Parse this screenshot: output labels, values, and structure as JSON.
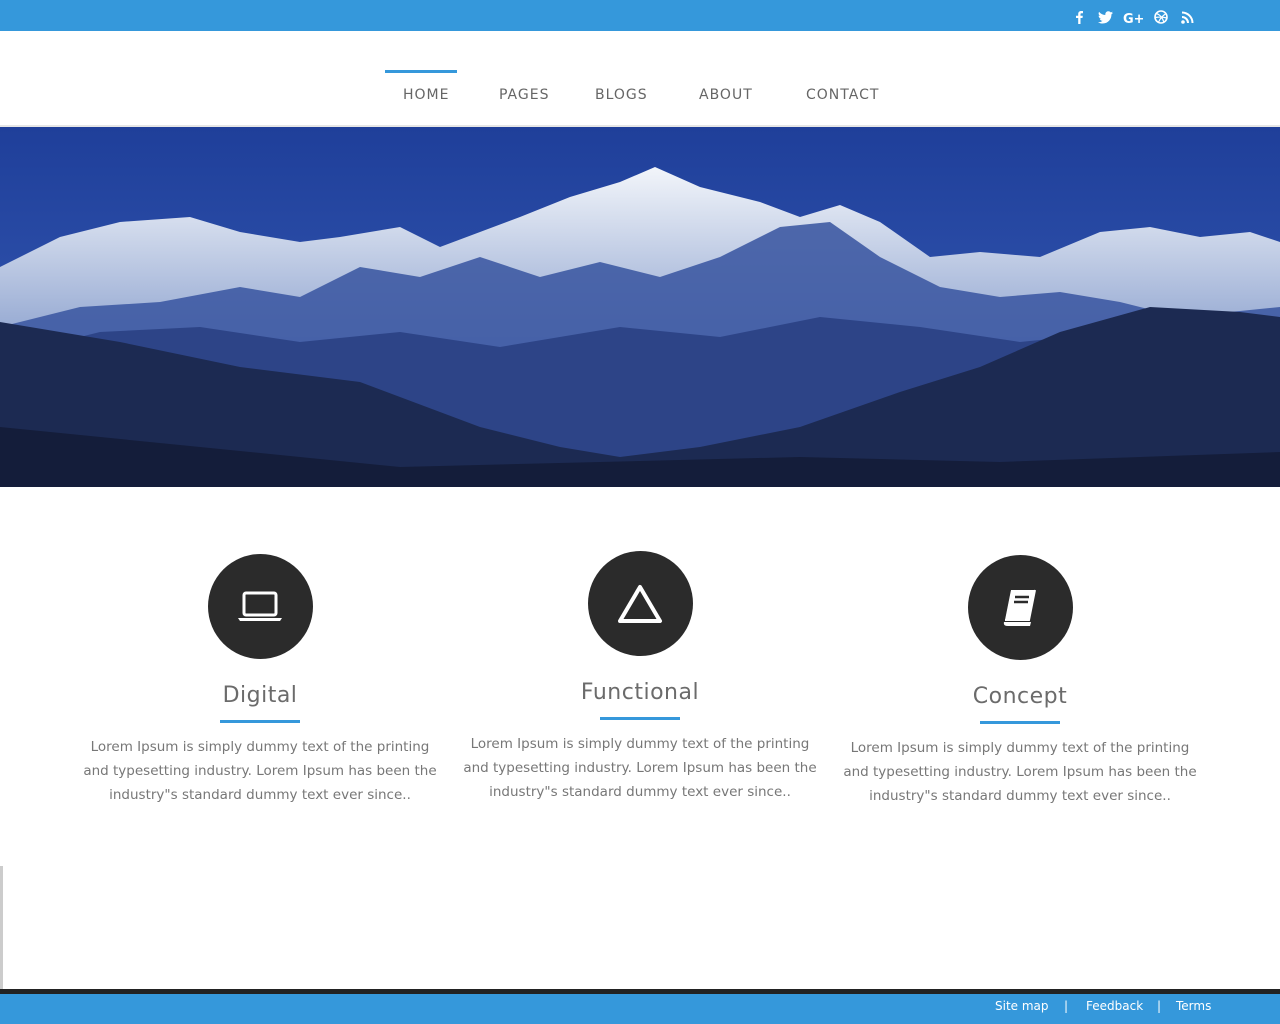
{
  "social": {
    "facebook": "f",
    "twitter": "t",
    "googleplus": "G+",
    "dribbble": "dribbble-icon",
    "rss": "rss-icon"
  },
  "nav": {
    "items": [
      "HOME",
      "PAGES",
      "BLOGS",
      "ABOUT",
      "CONTACT"
    ],
    "active": "HOME"
  },
  "hero": {
    "image": "mountain-range-hero-image"
  },
  "features": [
    {
      "icon": "laptop-icon",
      "title": "Digital",
      "text": "Lorem Ipsum is simply dummy text of the printing and typesetting industry. Lorem Ipsum has been the industry\"s standard dummy text ever since.."
    },
    {
      "icon": "triangle-icon",
      "title": "Functional",
      "text": "Lorem Ipsum is simply dummy text of the printing and typesetting industry. Lorem Ipsum has been the industry\"s standard dummy text ever since.."
    },
    {
      "icon": "book-icon",
      "title": "Concept",
      "text": "Lorem Ipsum is simply dummy text of the printing and typesetting industry. Lorem Ipsum has been the industry\"s standard dummy text ever since.."
    }
  ],
  "footer": {
    "links": [
      "Site map",
      "Feedback",
      "Terms"
    ],
    "separator": "|"
  },
  "colors": {
    "accent": "#3598db",
    "circle": "#2b2b2b",
    "footer_dark": "#222222"
  }
}
